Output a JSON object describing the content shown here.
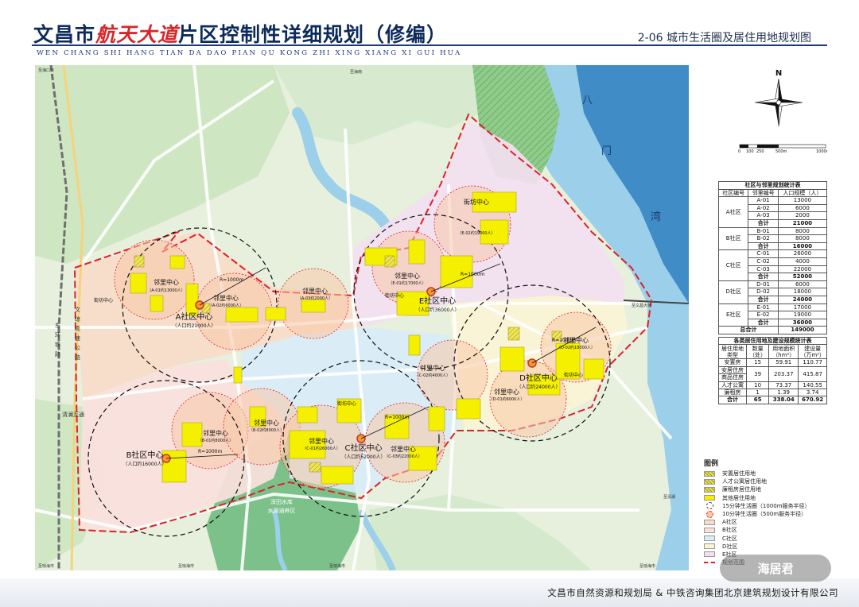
{
  "header": {
    "title_pre": "文昌市",
    "title_accent": "航天大道",
    "title_post": "片区控制性详细规划（修编）",
    "pinyin": "WEN CHANG SHI HANG TIAN DA DAO PIAN QU KONG ZHI XING XIANG XI GUI HUA",
    "sheet": "2-06  城市生活圈及居住用地规划图"
  },
  "footer": "文昌市自然资源和规划局 & 中铁咨询集团北京建筑规划设计有限公司",
  "watermark": "海居君",
  "compass": {
    "north": "N"
  },
  "scale": {
    "ticks": [
      "0",
      "100",
      "250",
      "500m",
      "1000m"
    ]
  },
  "map": {
    "water_labels": [
      "八",
      "门",
      "湾"
    ],
    "road_labels": [
      "东",
      "环",
      "铁",
      "路",
      "文",
      "琼",
      "高",
      "速",
      "公",
      "路",
      "清澜互通"
    ],
    "edge_labels": [
      "至海口市",
      "至海口市",
      "至海南",
      "至清澜",
      "至文昌大桥",
      "至琼海市",
      "至琼海市",
      "至琼海市",
      "至琼海市",
      "至琼海市",
      "至琼海市",
      "至清澜"
    ],
    "reservoir": [
      "深田水库",
      "水源涵养区"
    ],
    "communities": [
      {
        "name": "A社区中心",
        "pop": "（人口约21000人）"
      },
      {
        "name": "B社区中心",
        "pop": "（人口约16000人）"
      },
      {
        "name": "C社区中心",
        "pop": "（人口约52000人）"
      },
      {
        "name": "D社区中心",
        "pop": "（人口约24000人）"
      },
      {
        "name": "E社区中心",
        "pop": "（人口约36000人）"
      }
    ],
    "neighborhoods": [
      {
        "name": "邻里中心",
        "pop": "（A-01约13000人）"
      },
      {
        "name": "邻里中心",
        "pop": "（A-02约6000人）"
      },
      {
        "name": "邻里中心",
        "pop": "（A-03约2000人）"
      },
      {
        "name": "邻里中心",
        "pop": "（B-01约8000人）"
      },
      {
        "name": "邻里中心",
        "pop": "（B-02约8000人）"
      },
      {
        "name": "邻里中心",
        "pop": "（C-01约26000人）"
      },
      {
        "name": "邻里中心",
        "pop": "（C-02约4000人）"
      },
      {
        "name": "邻里中心",
        "pop": "（C-03约22000人）"
      },
      {
        "name": "邻里中心",
        "pop": "（D-01约6000人）"
      },
      {
        "name": "邻里中心",
        "pop": "（D-02约18000人）"
      },
      {
        "name": "邻里中心",
        "pop": "（E-01约17000人）"
      },
      {
        "name": "街坊中心",
        "pop": "（E-02约19000人）"
      }
    ],
    "small_labels": [
      "街坊中心",
      "R=1000m",
      "R=500m"
    ]
  },
  "table1": {
    "caption": "社区与邻里规划统计表",
    "headers": [
      "社区编号",
      "邻里编号",
      "人口规模（人）"
    ],
    "groups": [
      {
        "community": "A社区",
        "rows": [
          [
            "A-01",
            "13000"
          ],
          [
            "A-02",
            "6000"
          ],
          [
            "A-03",
            "2000"
          ]
        ],
        "total": "21000"
      },
      {
        "community": "B社区",
        "rows": [
          [
            "B-01",
            "8000"
          ],
          [
            "B-02",
            "8000"
          ]
        ],
        "total": "16000"
      },
      {
        "community": "C社区",
        "rows": [
          [
            "C-01",
            "26000"
          ],
          [
            "C-02",
            "4000"
          ],
          [
            "C-03",
            "22000"
          ]
        ],
        "total": "52000"
      },
      {
        "community": "D社区",
        "rows": [
          [
            "D-01",
            "6000"
          ],
          [
            "D-02",
            "18000"
          ]
        ],
        "total": "24000"
      },
      {
        "community": "E社区",
        "rows": [
          [
            "E-01",
            "17000"
          ],
          [
            "E-02",
            "19000"
          ]
        ],
        "total": "36000"
      }
    ],
    "total_label": "合计",
    "grand_label": "总合计",
    "grand_total": "149000"
  },
  "table2": {
    "caption": "各类居住用地及建设规模统计表",
    "headers": [
      "居住用地类型",
      "数量（处）",
      "用地面积（hm²）",
      "建设量（万m²）"
    ],
    "rows": [
      [
        "安置房",
        "15",
        "59.91",
        "110.77"
      ],
      [
        "安居住房",
        "39",
        "203.37",
        "415.87"
      ],
      [
        "商品住房",
        "",
        "",
        ""
      ],
      [
        "人才公寓",
        "10",
        "73.37",
        "140.55"
      ],
      [
        "廉租房",
        "1",
        "1.39",
        "3.74"
      ]
    ],
    "total": [
      "合计",
      "65",
      "338.04",
      "670.92"
    ]
  },
  "legend": {
    "title": "图例",
    "items": [
      {
        "label": "安置居住用地",
        "color": "#f2e650"
      },
      {
        "label": "人才公寓居住用地",
        "color": "#f2e650"
      },
      {
        "label": "廉租房居住用地",
        "color": "#f2e650"
      },
      {
        "label": "其他居住用地",
        "color": "#f5f000"
      },
      {
        "label": "15分钟生活圈（1000m服务半径）",
        "color": "#ffffff"
      },
      {
        "label": "10分钟生活圈（500m服务半径）",
        "color": "#f7c9a8"
      },
      {
        "label": "A社区",
        "color": "#f9dcc8"
      },
      {
        "label": "B社区",
        "color": "#fbe1dc"
      },
      {
        "label": "C社区",
        "color": "#d9ecf7"
      },
      {
        "label": "D社区",
        "color": "#fbf4d4"
      },
      {
        "label": "E社区",
        "color": "#f3dff0"
      },
      {
        "label": "规划范围",
        "color": "#e0202c"
      }
    ]
  }
}
